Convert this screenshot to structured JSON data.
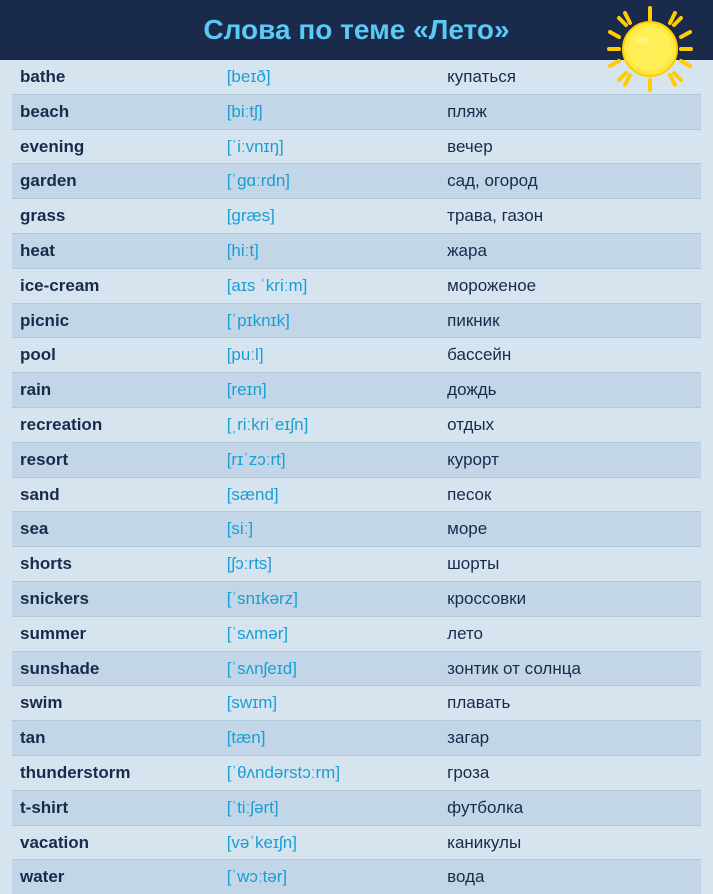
{
  "header": {
    "title": "Слова по теме «Лето»"
  },
  "words": [
    {
      "word": "bathe",
      "phonetic": "[beɪð]",
      "translation": "купаться"
    },
    {
      "word": "beach",
      "phonetic": "[biːtʃ]",
      "translation": "пляж"
    },
    {
      "word": "evening",
      "phonetic": "[ˈiːvnɪŋ]",
      "translation": "вечер"
    },
    {
      "word": "garden",
      "phonetic": "[ˈɡɑːrdn]",
      "translation": "сад, огород"
    },
    {
      "word": "grass",
      "phonetic": "[ɡræs]",
      "translation": "трава, газон"
    },
    {
      "word": "heat",
      "phonetic": "[hiːt]",
      "translation": "жара"
    },
    {
      "word": "ice-cream",
      "phonetic": "[aɪs ˈkriːm]",
      "translation": "мороженое"
    },
    {
      "word": "picnic",
      "phonetic": "[ˈpɪknɪk]",
      "translation": "пикник"
    },
    {
      "word": "pool",
      "phonetic": "[puːl]",
      "translation": "бассейн"
    },
    {
      "word": "rain",
      "phonetic": "[reɪn]",
      "translation": "дождь"
    },
    {
      "word": "recreation",
      "phonetic": "[ˌriːkriˈeɪʃn]",
      "translation": "отдых"
    },
    {
      "word": "resort",
      "phonetic": "[rɪˈzɔːrt]",
      "translation": "курорт"
    },
    {
      "word": "sand",
      "phonetic": "[sænd]",
      "translation": "песок"
    },
    {
      "word": "sea",
      "phonetic": "[siː]",
      "translation": "море"
    },
    {
      "word": "shorts",
      "phonetic": "[ʃɔːrts]",
      "translation": "шорты"
    },
    {
      "word": "snickers",
      "phonetic": "[ˈsnɪkərz]",
      "translation": "кроссовки"
    },
    {
      "word": "summer",
      "phonetic": "[ˈsʌmər]",
      "translation": "лето"
    },
    {
      "word": "sunshade",
      "phonetic": "[ˈsʌnʃeɪd]",
      "translation": "зонтик от солнца"
    },
    {
      "word": "swim",
      "phonetic": "[swɪm]",
      "translation": "плавать"
    },
    {
      "word": "tan",
      "phonetic": "[tæn]",
      "translation": "загар"
    },
    {
      "word": "thunderstorm",
      "phonetic": "[ˈθʌndərstɔːrm]",
      "translation": "гроза"
    },
    {
      "word": "t-shirt",
      "phonetic": "[ˈtiːʃərt]",
      "translation": "футболка"
    },
    {
      "word": "vacation",
      "phonetic": "[vəˈkeɪʃn]",
      "translation": "каникулы"
    },
    {
      "word": "water",
      "phonetic": "[ˈwɔːtər]",
      "translation": "вода"
    }
  ]
}
